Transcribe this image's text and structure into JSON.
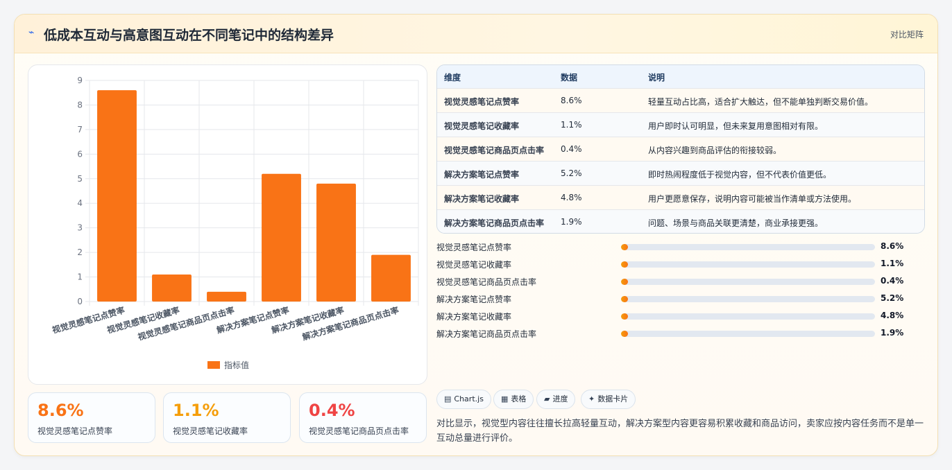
{
  "header": {
    "icon": "trend-icon",
    "title": "低成本互动与高意图互动在不同笔记中的结构差异",
    "tag": "对比矩阵"
  },
  "chart_data": {
    "type": "bar",
    "categories": [
      "视觉灵感笔记点赞率",
      "视觉灵感笔记收藏率",
      "视觉灵感笔记商品页点击率",
      "解决方案笔记点赞率",
      "解决方案笔记收藏率",
      "解决方案笔记商品页点击率"
    ],
    "series": [
      {
        "name": "指标值",
        "values": [
          8.6,
          1.1,
          0.4,
          5.2,
          4.8,
          1.9
        ],
        "color": "#f97316"
      }
    ],
    "ylim": [
      0,
      9
    ],
    "yticks": [
      0,
      1,
      2,
      3,
      4,
      5,
      6,
      7,
      8,
      9
    ],
    "grid": true,
    "legend": "bottom"
  },
  "stats": [
    {
      "value": "8.6%",
      "label": "视觉灵感笔记点赞率",
      "color": "#f97316"
    },
    {
      "value": "1.1%",
      "label": "视觉灵感笔记收藏率",
      "color": "#f59e0b"
    },
    {
      "value": "0.4%",
      "label": "视觉灵感笔记商品页点击率",
      "color": "#ef4444"
    }
  ],
  "table": {
    "headers": [
      "维度",
      "数据",
      "说明"
    ],
    "rows": [
      [
        "视觉灵感笔记点赞率",
        "8.6%",
        "轻量互动占比高，适合扩大触达，但不能单独判断交易价值。"
      ],
      [
        "视觉灵感笔记收藏率",
        "1.1%",
        "用户即时认可明显，但未来复用意图相对有限。"
      ],
      [
        "视觉灵感笔记商品页点击率",
        "0.4%",
        "从内容兴趣到商品评估的衔接较弱。"
      ],
      [
        "解决方案笔记点赞率",
        "5.2%",
        "即时热闹程度低于视觉内容，但不代表价值更低。"
      ],
      [
        "解决方案笔记收藏率",
        "4.8%",
        "用户更愿意保存，说明内容可能被当作清单或方法使用。"
      ],
      [
        "解决方案笔记商品页点击率",
        "1.9%",
        "问题、场景与商品关联更清楚，商业承接更强。"
      ]
    ]
  },
  "progress": [
    {
      "label": "视觉灵感笔记点赞率",
      "value": "8.6%",
      "fraction": 0.0
    },
    {
      "label": "视觉灵感笔记收藏率",
      "value": "1.1%",
      "fraction": 0.0
    },
    {
      "label": "视觉灵感笔记商品页点击率",
      "value": "0.4%",
      "fraction": 0.0
    },
    {
      "label": "解决方案笔记点赞率",
      "value": "5.2%",
      "fraction": 0.0
    },
    {
      "label": "解决方案笔记收藏率",
      "value": "4.8%",
      "fraction": 0.0
    },
    {
      "label": "解决方案笔记商品页点击率",
      "value": "1.9%",
      "fraction": 0.0
    }
  ],
  "chips": [
    {
      "icon": "chart-icon",
      "glyph": "▤",
      "label": "Chart.js"
    },
    {
      "icon": "table-icon",
      "glyph": "▦",
      "label": "表格"
    },
    {
      "icon": "progress-icon",
      "glyph": "▰",
      "label": "进度"
    },
    {
      "icon": "sparkle-icon",
      "glyph": "✦",
      "label": "数据卡片"
    }
  ],
  "summary": "对比显示，视觉型内容往往擅长拉高轻量互动，解决方案型内容更容易积累收藏和商品访问，卖家应按内容任务而不是单一互动总量进行评价。"
}
